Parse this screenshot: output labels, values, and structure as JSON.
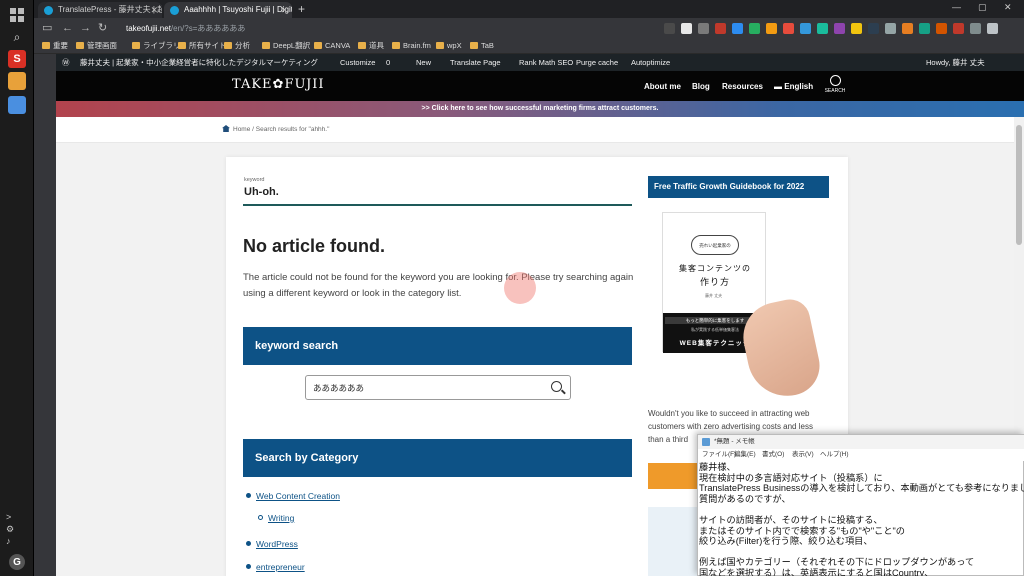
{
  "browser": {
    "tabs": [
      {
        "title": "TranslatePress - 藤井丈夫 | 起業家"
      },
      {
        "title": "Aaahhhh | Tsuyoshi Fujii | Digital"
      }
    ],
    "new_tab": "+",
    "url_host": "takeofujii.net",
    "url_path": "/en/?s=ああああああ",
    "window_controls": [
      "—",
      "▢",
      "✕"
    ],
    "bookmarks": [
      "重要",
      "管理画面",
      "ライブラリ",
      "所有サイト",
      "分析",
      "DeepL翻訳",
      "CANVA",
      "道具",
      "Brain.fm",
      "wpX",
      "TaB"
    ],
    "extension_colors": [
      "#4a4a4a",
      "#e8e8e8",
      "#7a7a7a",
      "#c0392b",
      "#2d8cf0",
      "#27ae60",
      "#f39c12",
      "#e74c3c",
      "#3498db",
      "#1abc9c",
      "#8e44ad",
      "#f1c40f",
      "#2c3e50",
      "#95a5a6",
      "#e67e22",
      "#16a085",
      "#d35400",
      "#c0392b",
      "#7f8c8d",
      "#bdc3c7"
    ]
  },
  "wp_admin": {
    "site_name": "藤井丈夫 | 起業家・中小企業経営者に特化したデジタルマーケティング",
    "customize": "Customize",
    "comments": "0",
    "new": "New",
    "translate": "Translate Page",
    "rankmath": "Rank Math SEO",
    "purge": "Purge cache",
    "autoptimize": "Autoptimize",
    "howdy": "Howdy, 藤井 丈夫"
  },
  "site": {
    "logo": "TAKE✿FUJII",
    "nav": [
      "About me",
      "Blog",
      "Resources",
      "English"
    ],
    "search_label": "SEARCH",
    "banner": ">> Click here to see how successful marketing firms attract customers.",
    "breadcrumb_home": "Home",
    "breadcrumb_sep": "/",
    "breadcrumb_current": "Search results for \"ahhh.\""
  },
  "main": {
    "keyword_label": "keyword",
    "keyword_value": "Uh-oh.",
    "not_found_title": "No article found.",
    "not_found_desc": "The article could not be found for the keyword you are looking for. Please try searching again using a different keyword or look in the category list.",
    "keyword_search_heading": "keyword search",
    "search_value": "ああああああ",
    "category_heading": "Search by Category",
    "categories": [
      "Web Content Creation",
      "Writing",
      "WordPress",
      "entrepreneur"
    ]
  },
  "sidebar": {
    "heading": "Free Traffic Growth Guidebook for 2022",
    "book_cloud": "売れい起業家の",
    "book_title_1": "集客コンテンツの",
    "book_title_2": "作り方",
    "book_author": "藤井 丈夫",
    "book_band_1": "もっと簡単的に集客をします",
    "book_band_2": "私が実践する低単価集客法",
    "book_band_3": "WEB集客テクニック",
    "desc": "Wouldn't you like to succeed in attracting web customers with zero advertising costs and less than a third"
  },
  "notepad": {
    "title": "*無題 - メモ帳",
    "menu": [
      "ファイル(F)",
      "編集(E)",
      "書式(O)",
      "表示(V)",
      "ヘルプ(H)"
    ],
    "lines": [
      "藤井様、",
      "現在検討中の多言語対応サイト（投稿系）に",
      "TranslatePress Businessの導入を検討しており、本動画がとても参考になりました。",
      "質問があるのですが、",
      "",
      "サイトの訪問者が、そのサイトに投稿する、",
      "またはそのサイト内でで検索する\"もの\"や\"こと\"の",
      "絞り込み(Filter)を行う際、絞り込む項目、",
      "",
      "例えば国やカテゴリー（それぞれその下にドロップダウンがあって",
      "国などを選択する）は、英語表示にすると国はCountry、"
    ]
  }
}
